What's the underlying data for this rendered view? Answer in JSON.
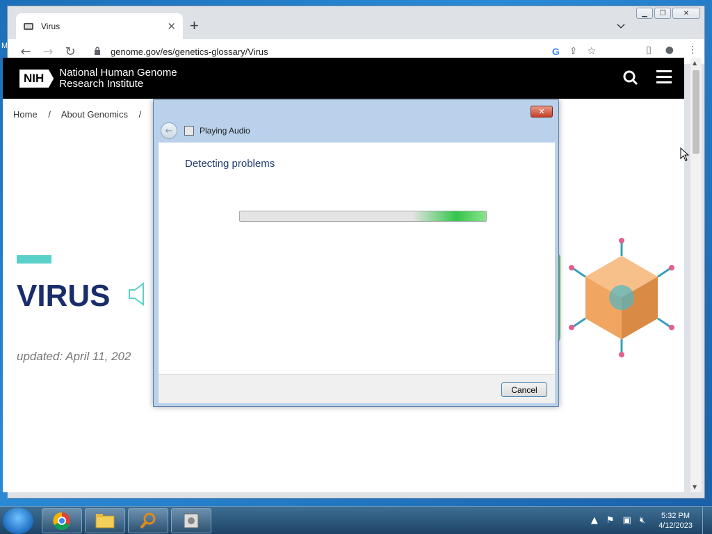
{
  "browser": {
    "tab_title": "Virus",
    "new_tab": "+",
    "url": "genome.gov/es/genetics-glossary/Virus"
  },
  "page": {
    "org_name_line1": "National Human Genome",
    "org_name_line2": "Research Institute",
    "logo_text": "NIH",
    "breadcrumb": [
      "Home",
      "/",
      "About Genomics",
      "/"
    ],
    "heading": "VIRUS",
    "updated": "updated: April 11, 202"
  },
  "dialog": {
    "title": "Playing Audio",
    "status": "Detecting problems",
    "progress": 1.0,
    "cancel_label": "Cancel"
  },
  "taskbar": {
    "time": "5:32 PM",
    "date": "4/12/2023"
  },
  "colors": {
    "nih_navy": "#1a2d6b",
    "teal_accent": "#5ad1c8",
    "progress_green": "#33c64a"
  }
}
